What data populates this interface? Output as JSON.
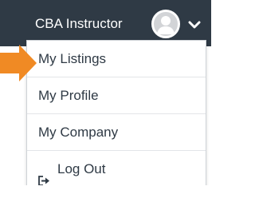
{
  "header": {
    "user_name": "CBA Instructor",
    "avatar_icon": "user-avatar-icon",
    "caret_icon": "chevron-down-icon"
  },
  "menu": {
    "items": [
      {
        "label": "My Listings"
      },
      {
        "label": "My Profile"
      },
      {
        "label": "My Company"
      },
      {
        "label": "Log Out",
        "icon": "logout-icon"
      }
    ]
  },
  "annotation": {
    "arrow_color": "#f08a24"
  },
  "colors": {
    "header_bg": "#2f3a45",
    "menu_text": "#2f3a45",
    "divider": "#e3e5e8"
  }
}
